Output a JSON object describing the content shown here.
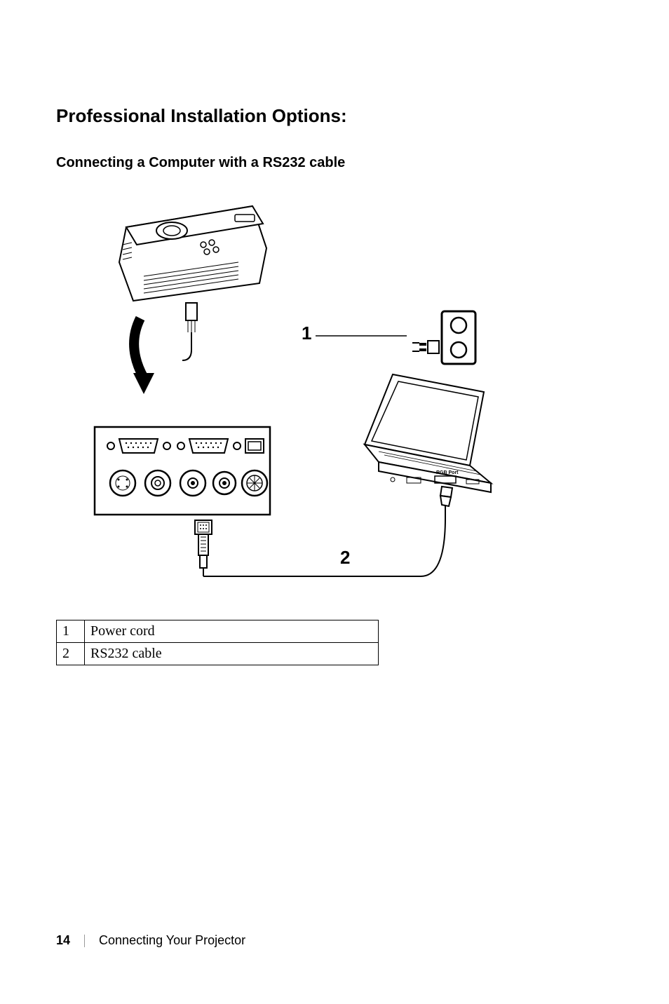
{
  "headings": {
    "main": "Professional Installation Options:",
    "sub": "Connecting a Computer with a RS232 cable"
  },
  "diagram": {
    "callouts": [
      "1",
      "2"
    ],
    "port_label": "RGB Port"
  },
  "legend": {
    "rows": [
      {
        "num": "1",
        "label": "Power cord"
      },
      {
        "num": "2",
        "label": "RS232 cable"
      }
    ]
  },
  "footer": {
    "page": "14",
    "section": "Connecting Your Projector"
  }
}
